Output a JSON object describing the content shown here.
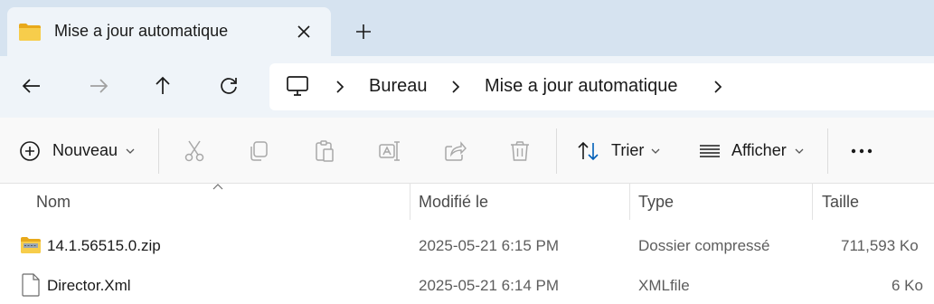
{
  "tab": {
    "title": "Mise a jour automatique",
    "icon": "folder-icon"
  },
  "nav": {
    "back_icon": "arrow-left-icon",
    "forward_icon": "arrow-right-icon",
    "up_icon": "arrow-up-icon",
    "refresh_icon": "refresh-icon"
  },
  "breadcrumb": {
    "root_icon": "monitor-icon",
    "items": [
      "Bureau",
      "Mise a jour automatique"
    ]
  },
  "toolbar": {
    "new_label": "Nouveau",
    "sort_label": "Trier",
    "view_label": "Afficher",
    "icons": [
      "plus-circle-icon",
      "cut-icon",
      "copy-icon",
      "paste-icon",
      "rename-icon",
      "share-icon",
      "delete-icon",
      "sort-icon",
      "view-icon",
      "more-icon"
    ]
  },
  "columns": [
    "Nom",
    "Modifié le",
    "Type",
    "Taille"
  ],
  "files": [
    {
      "name": "14.1.56515.0.zip",
      "modified": "2025-05-21 6:15 PM",
      "type": "Dossier compressé",
      "size": "711,593 Ko",
      "icon": "zip-folder-icon"
    },
    {
      "name": "Director.Xml",
      "modified": "2025-05-21 6:14 PM",
      "type": "XMLfile",
      "size": "6 Ko",
      "icon": "file-icon"
    }
  ],
  "colors": {
    "tabstrip": "#d6e3f0",
    "navrow": "#eff4f9",
    "accent": "#005fb8",
    "folder": "#f4c542"
  }
}
